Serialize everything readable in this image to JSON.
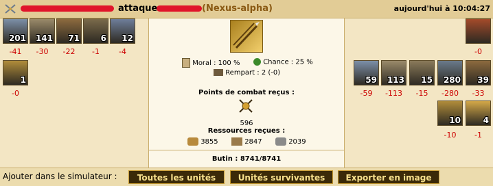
{
  "header": {
    "action": "attaque",
    "defender_city": "(Nexus-alpha)",
    "timestamp": "aujourd'hui à 10:04:27",
    "icon": "crossed-swords-icon"
  },
  "attacker": {
    "units": [
      {
        "name": "hoplite",
        "count": "201",
        "loss": "-41",
        "color": "#7c8fa8"
      },
      {
        "name": "sword-soldier",
        "count": "141",
        "loss": "-30",
        "color": "#9a8a6a"
      },
      {
        "name": "horseman",
        "count": "71",
        "loss": "-22",
        "color": "#8c6a3e"
      },
      {
        "name": "chariot",
        "count": "6",
        "loss": "-1",
        "color": "#7a6a4a"
      },
      {
        "name": "griffin",
        "count": "12",
        "loss": "-4",
        "color": "#6e7e9a"
      },
      {
        "name": "hero",
        "count": "1",
        "loss": "-0",
        "color": "#b08c3a"
      }
    ]
  },
  "defender": {
    "units": [
      {
        "name": "transport-ship",
        "count": "",
        "loss": "-0",
        "color": "#a34a2a"
      },
      {
        "name": "hoplite",
        "count": "59",
        "loss": "-59",
        "color": "#7c8fa8"
      },
      {
        "name": "sword-soldier",
        "count": "113",
        "loss": "-113",
        "color": "#9a8a6a"
      },
      {
        "name": "archer",
        "count": "15",
        "loss": "-15",
        "color": "#8a7a5a"
      },
      {
        "name": "slinger",
        "count": "280",
        "loss": "-280",
        "color": "#6a7a8a"
      },
      {
        "name": "horseman",
        "count": "39",
        "loss": "-33",
        "color": "#8c6a3e"
      },
      {
        "name": "hero-warrior",
        "count": "10",
        "loss": "-10",
        "color": "#b08c3a"
      },
      {
        "name": "hero-woman",
        "count": "4",
        "loss": "-1",
        "color": "#d4a848"
      }
    ]
  },
  "battle": {
    "moral_label": "Moral : 100 %",
    "chance_label": "Chance : 25 %",
    "rampart_label": "Rempart : 2 (-0)",
    "combat_points_title": "Points de combat reçus :",
    "combat_points_value": "596",
    "resources_title": "Ressources reçues :",
    "wood": "3855",
    "stone": "2847",
    "silver": "2039",
    "booty": "Butin : 8741/8741"
  },
  "footer": {
    "label": "Ajouter dans le simulateur :",
    "btn_all": "Toutes les unités",
    "btn_survivors": "Unités survivantes",
    "btn_export": "Exporter en image"
  },
  "colors": {
    "accent": "#8a5a14",
    "loss": "#cc0000",
    "button_bg": "#3b2a08",
    "button_text": "#f7e08d"
  }
}
